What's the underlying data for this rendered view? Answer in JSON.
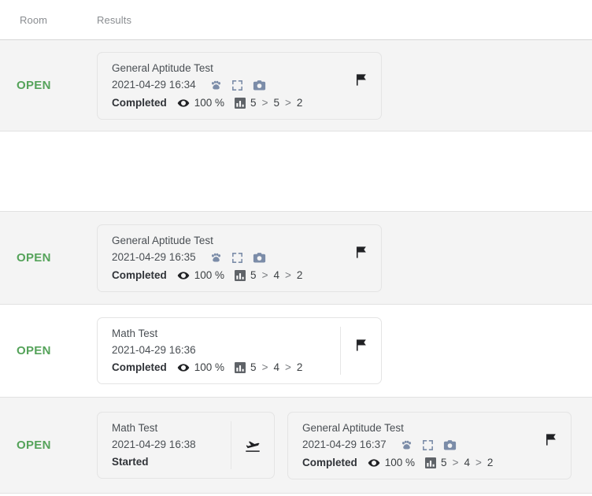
{
  "header": {
    "columns": [
      {
        "key": "room",
        "label": "Room"
      },
      {
        "key": "results",
        "label": "Results"
      }
    ]
  },
  "status_colors": {
    "open": "#55a35a",
    "icon_blue": "#7b8ca8",
    "icon_dark": "#202124"
  },
  "labels": {
    "open": "OPEN",
    "completed": "Completed",
    "started": "Started",
    "percent_100": "100 %",
    "chevron": ">"
  },
  "icons": {
    "paw": "paw-print-icon",
    "fullscreen": "fullscreen-icon",
    "camera": "camera-icon",
    "eye": "eye-icon",
    "bar_chart": "bar-chart-icon",
    "flag": "flag-icon",
    "flight": "flight-takeoff-icon"
  },
  "rows": [
    {
      "room_status": "OPEN",
      "cards": [
        {
          "title": "General Aptitude Test",
          "date": "2021-04-29 16:34",
          "status": "Completed",
          "visibility": "100 %",
          "scores": [
            "5",
            "5",
            "2"
          ],
          "has_paw": true,
          "has_fullscreen": true,
          "has_camera": true,
          "right_icon": "flag"
        }
      ]
    },
    {
      "room_status": "",
      "cards": []
    },
    {
      "room_status": "OPEN",
      "cards": [
        {
          "title": "General Aptitude Test",
          "date": "2021-04-29 16:35",
          "status": "Completed",
          "visibility": "100 %",
          "scores": [
            "5",
            "4",
            "2"
          ],
          "has_paw": true,
          "has_fullscreen": true,
          "has_camera": true,
          "right_icon": "flag"
        }
      ]
    },
    {
      "room_status": "OPEN",
      "cards": [
        {
          "title": "Math Test",
          "date": "2021-04-29 16:36",
          "status": "Completed",
          "visibility": "100 %",
          "scores": [
            "5",
            "4",
            "2"
          ],
          "has_paw": false,
          "has_fullscreen": false,
          "has_camera": false,
          "right_icon": "flag"
        }
      ]
    },
    {
      "room_status": "OPEN",
      "cards": [
        {
          "title": "Math Test",
          "date": "2021-04-29 16:38",
          "status": "Started",
          "visibility": "",
          "scores": [],
          "has_paw": false,
          "has_fullscreen": false,
          "has_camera": false,
          "right_icon": "flight"
        },
        {
          "title": "General Aptitude Test",
          "date": "2021-04-29 16:37",
          "status": "Completed",
          "visibility": "100 %",
          "scores": [
            "5",
            "4",
            "2"
          ],
          "has_paw": true,
          "has_fullscreen": true,
          "has_camera": true,
          "right_icon": "flag"
        }
      ]
    }
  ]
}
